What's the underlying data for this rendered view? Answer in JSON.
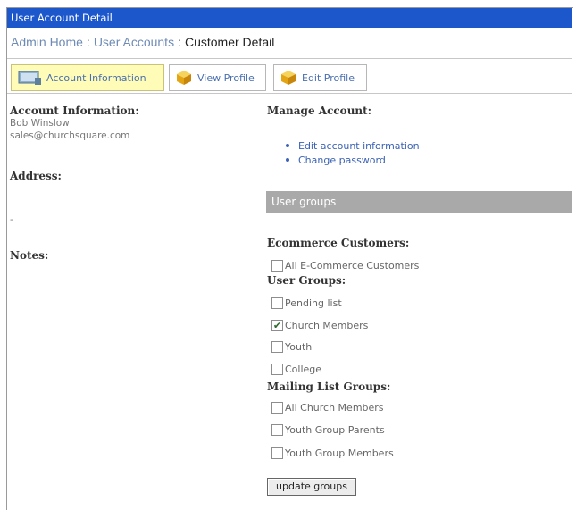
{
  "window": {
    "title": "User Account Detail"
  },
  "breadcrumb": {
    "items": [
      "Admin Home",
      "User Accounts",
      "Customer Detail"
    ],
    "separator": ":"
  },
  "tabs": [
    {
      "label": "Account Information",
      "icon": "monitor-icon",
      "active": true
    },
    {
      "label": "View Profile",
      "icon": "box-icon",
      "active": false
    },
    {
      "label": "Edit Profile",
      "icon": "box-icon",
      "active": false
    }
  ],
  "account": {
    "heading": "Account Information:",
    "name": "Bob Winslow",
    "email": "sales@churchsquare.com",
    "address_heading": "Address:",
    "address_value": "-",
    "notes_heading": "Notes:"
  },
  "manage": {
    "heading": "Manage Account:",
    "links": [
      "Edit account information",
      "Change password"
    ]
  },
  "user_groups_bar": "User groups",
  "groups": {
    "ecommerce_heading": "Ecommerce Customers:",
    "ecommerce": [
      {
        "label": "All E-Commerce Customers",
        "checked": false
      }
    ],
    "user_heading": "User Groups:",
    "user": [
      {
        "label": "Pending list",
        "checked": false
      },
      {
        "label": "Church Members",
        "checked": true
      },
      {
        "label": "Youth",
        "checked": false
      },
      {
        "label": "College",
        "checked": false
      }
    ],
    "mailing_heading": "Mailing List Groups:",
    "mailing": [
      {
        "label": "All Church Members",
        "checked": false
      },
      {
        "label": "Youth Group Parents",
        "checked": false
      },
      {
        "label": "Youth Group Members",
        "checked": false
      }
    ]
  },
  "update_button": "update groups",
  "colors": {
    "titlebar": "#1d57cc",
    "active_tab": "#fffcb8",
    "link": "#3b62b5",
    "groups_bar": "#a9a9a9"
  }
}
